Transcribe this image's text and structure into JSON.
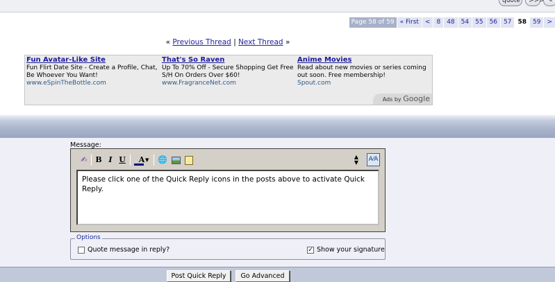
{
  "top_buttons": {
    "quote": "quote",
    "multi": ">>>",
    "edit": ""
  },
  "pagination": {
    "label": "Page 58 of 59",
    "first": "« First",
    "prev": "<",
    "pages": [
      "8",
      "48",
      "54",
      "55",
      "56",
      "57",
      "58",
      "59"
    ],
    "current": "58",
    "next": ">"
  },
  "thread_nav": {
    "prev_arrow": "«",
    "previous": "Previous Thread",
    "separator": "|",
    "next": "Next Thread",
    "next_arrow": "»"
  },
  "ads": [
    {
      "title": "Fun Avatar-Like Site",
      "text": "Fun Flirt Date Site - Create a Profile, Chat, Be Whoever You Want!",
      "url": "www.eSpinTheBottle.com"
    },
    {
      "title": "That's So Raven",
      "text": "Up To 70% Off - Secure Shopping Get Free S/H On Orders Over $60!",
      "url": "www.FragranceNet.com"
    },
    {
      "title": "Anime Movies",
      "text": "Read about new movies or series coming out soon. Free membership!",
      "url": "Spout.com"
    }
  ],
  "ads_by": {
    "prefix": "Ads by",
    "brand": "Google"
  },
  "quick_reply": {
    "message_label": "Message:",
    "message_text": "Please click one of the Quick Reply icons in the posts above to activate Quick Reply.",
    "toolbar": {
      "bold": "B",
      "italic": "I",
      "underline": "U",
      "color": "A"
    },
    "options_legend": "Options",
    "quote_option": "Quote message in reply?",
    "quote_checked": false,
    "signature_option": "Show your signature",
    "signature_checked": true,
    "post_button": "Post Quick Reply",
    "advanced_button": "Go Advanced"
  }
}
